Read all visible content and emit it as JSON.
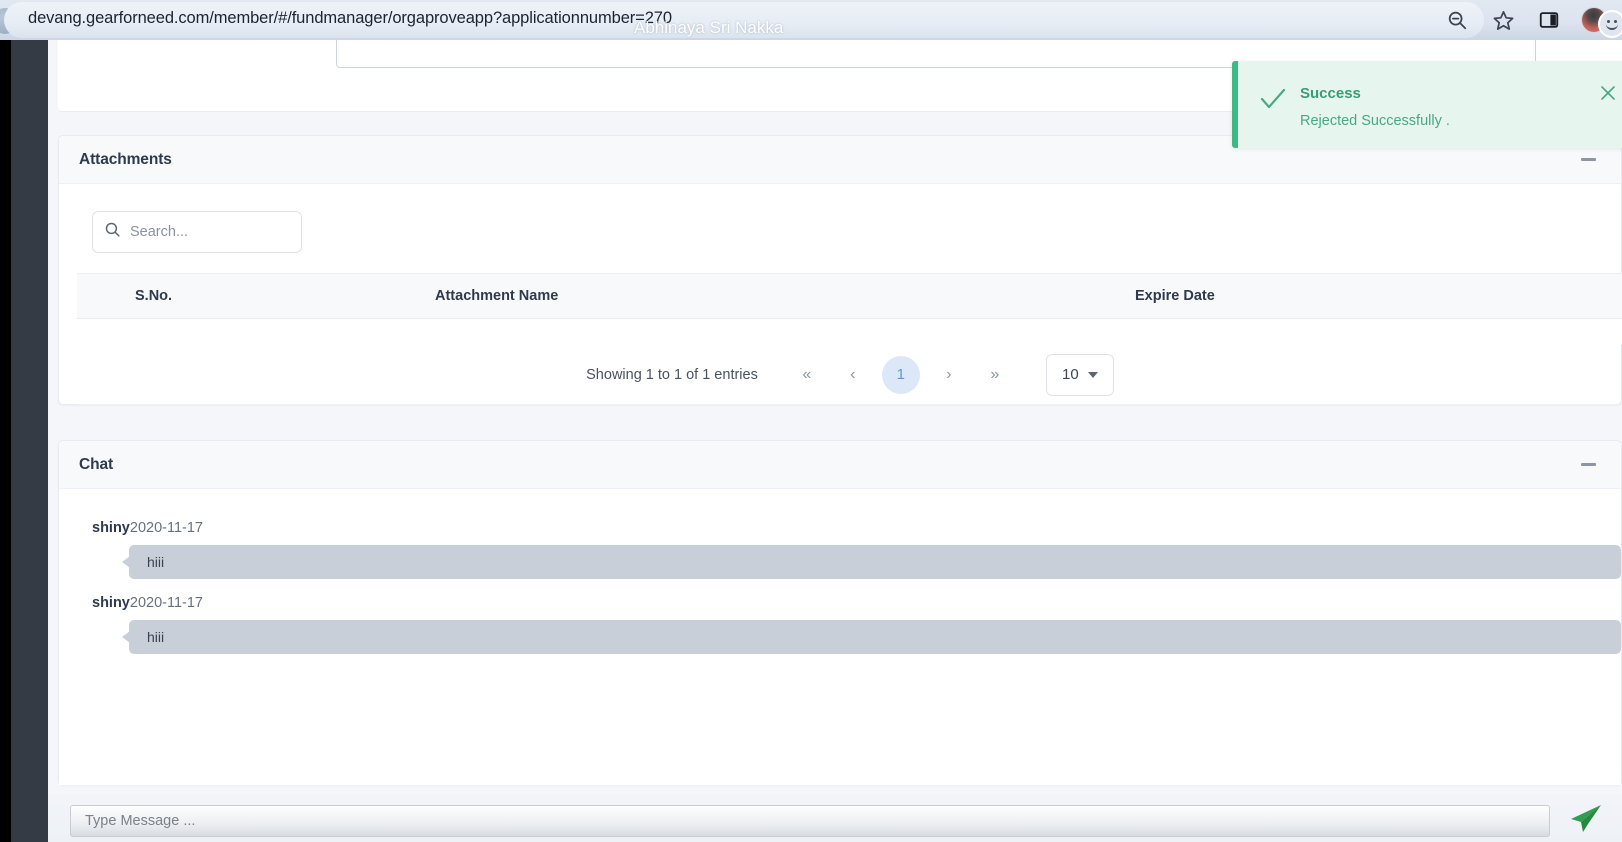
{
  "browser": {
    "url": "devang.gearforneed.com/member/#/fundmanager/orgaproveapp?applicationnumber=270",
    "watermark": "Abhinaya Sri Nakka",
    "icons": {
      "zoom_out": "zoom-out-icon",
      "bookmark": "star-icon",
      "side_panel": "side-panel-icon",
      "profile": "profile-avatar",
      "profile_badge": "smiley-icon"
    }
  },
  "toast": {
    "title": "Success",
    "message": "Rejected Successfully .",
    "accent_color": "#3fb984",
    "background_color": "#e6f6ee",
    "close_label": "×"
  },
  "attachments": {
    "title": "Attachments",
    "collapse_label": "–",
    "search": {
      "placeholder": "Search...",
      "value": ""
    },
    "columns": [
      "S.No.",
      "Attachment Name",
      "Expire Date"
    ],
    "rows": [],
    "pagination": {
      "info": "Showing 1 to 1 of 1 entries",
      "first": "«",
      "prev": "‹",
      "current_page": "1",
      "next": "›",
      "last": "»",
      "page_size": "10"
    }
  },
  "chat": {
    "title": "Chat",
    "collapse_label": "–",
    "messages": [
      {
        "user": "shiny",
        "date": "2020-11-17",
        "text": "hiii"
      },
      {
        "user": "shiny",
        "date": "2020-11-17",
        "text": "hiii"
      }
    ],
    "composer": {
      "placeholder": "Type Message ...",
      "value": "",
      "send_icon": "send-paper-plane-icon",
      "send_color": "#2f9e4f"
    }
  }
}
